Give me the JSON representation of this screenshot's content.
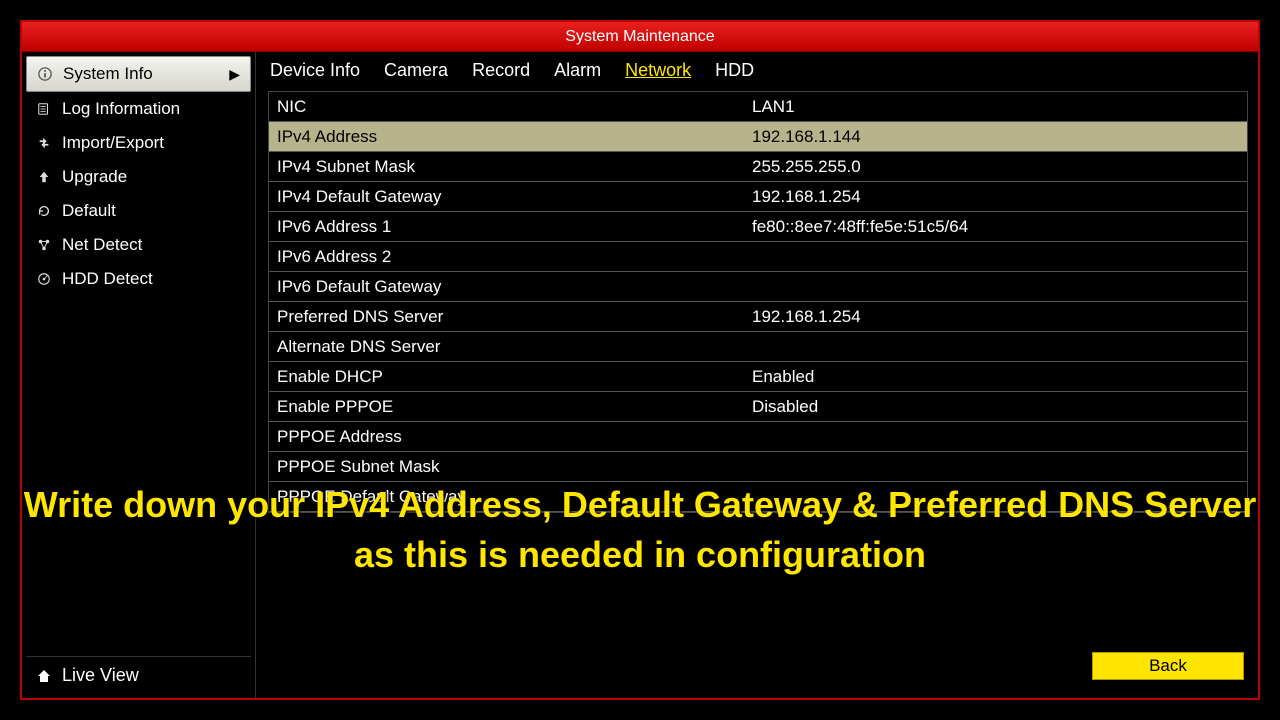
{
  "title": "System Maintenance",
  "sidebar": {
    "items": [
      {
        "label": "System Info",
        "active": true
      },
      {
        "label": "Log Information"
      },
      {
        "label": "Import/Export"
      },
      {
        "label": "Upgrade"
      },
      {
        "label": "Default"
      },
      {
        "label": "Net Detect"
      },
      {
        "label": "HDD Detect"
      }
    ],
    "liveview": "Live View"
  },
  "tabs": [
    {
      "label": "Device Info"
    },
    {
      "label": "Camera"
    },
    {
      "label": "Record"
    },
    {
      "label": "Alarm"
    },
    {
      "label": "Network",
      "active": true
    },
    {
      "label": "HDD"
    }
  ],
  "table": {
    "header": {
      "label": "NIC",
      "value": "LAN1"
    },
    "rows": [
      {
        "label": "IPv4 Address",
        "value": "192.168.1.144",
        "highlight": true
      },
      {
        "label": "IPv4 Subnet Mask",
        "value": "255.255.255.0"
      },
      {
        "label": "IPv4 Default Gateway",
        "value": "192.168.1.254"
      },
      {
        "label": "IPv6 Address 1",
        "value": "fe80::8ee7:48ff:fe5e:51c5/64"
      },
      {
        "label": "IPv6 Address 2",
        "value": ""
      },
      {
        "label": "IPv6 Default Gateway",
        "value": ""
      },
      {
        "label": "Preferred DNS Server",
        "value": "192.168.1.254"
      },
      {
        "label": "Alternate DNS Server",
        "value": ""
      },
      {
        "label": "Enable DHCP",
        "value": "Enabled"
      },
      {
        "label": "Enable PPPOE",
        "value": "Disabled"
      },
      {
        "label": "PPPOE Address",
        "value": ""
      },
      {
        "label": "PPPOE Subnet Mask",
        "value": ""
      },
      {
        "label": "PPPOE Default Gateway",
        "value": ""
      }
    ]
  },
  "caption": "Write down your IPv4 Address, Default Gateway & Preferred DNS Server as this is needed in configuration",
  "back": "Back"
}
